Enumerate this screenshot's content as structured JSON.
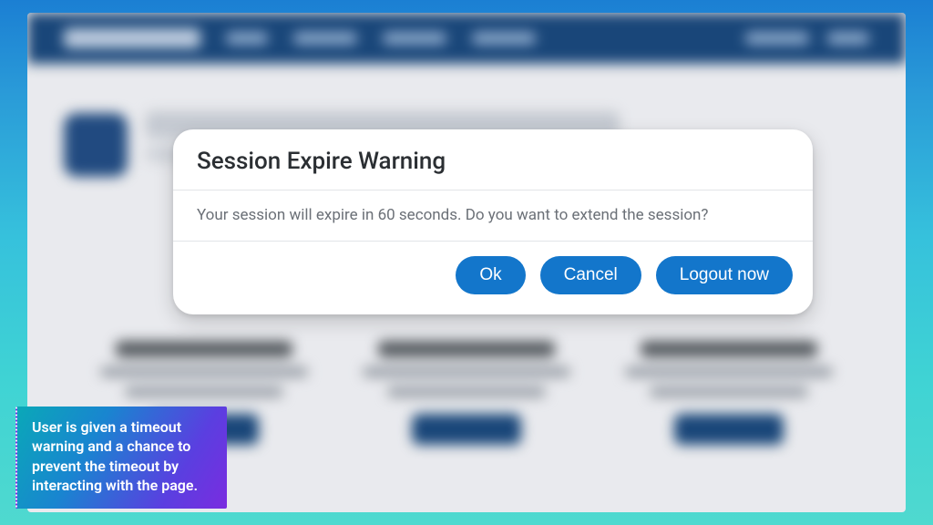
{
  "modal": {
    "title": "Session Expire Warning",
    "message": "Your session will expire in 60 seconds. Do you want to extend the session?",
    "buttons": {
      "ok": "Ok",
      "cancel": "Cancel",
      "logout": "Logout now"
    }
  },
  "annotation": {
    "text": "User is given a timeout warning and a chance to prevent the timeout by interacting with the page."
  }
}
